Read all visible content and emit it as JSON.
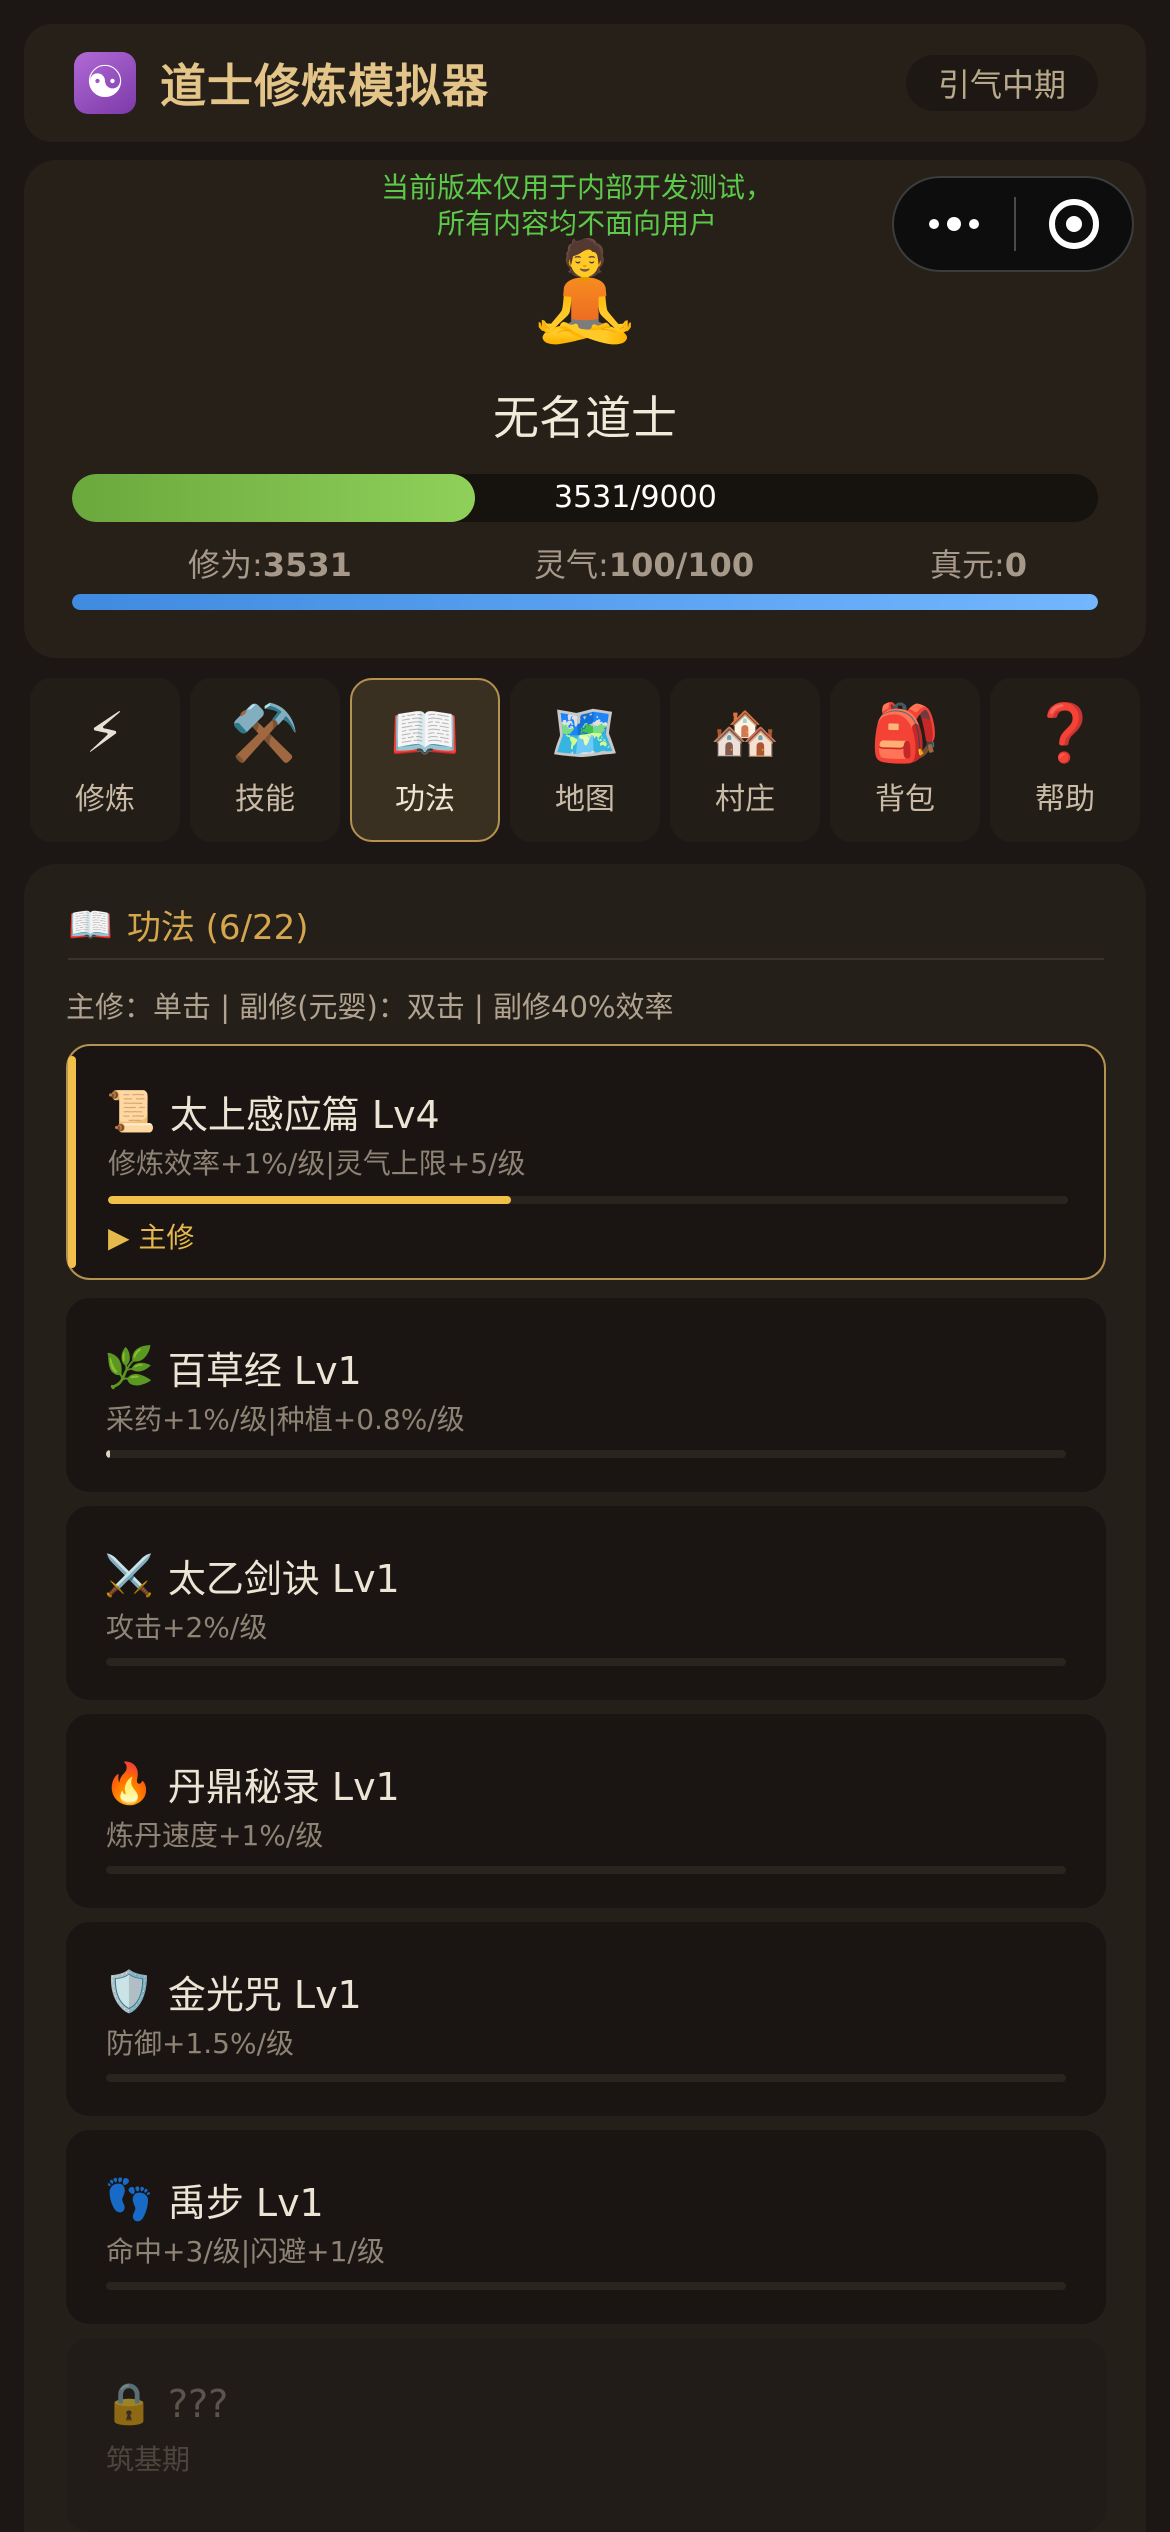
{
  "header": {
    "logo_icon": "☯",
    "title": "道士修炼模拟器",
    "realm": "引气中期"
  },
  "capsule": {
    "more_icon": "more-dots-icon",
    "close_icon": "target-close-icon"
  },
  "player": {
    "dev_notice_line1": "当前版本仅用于内部开发测试，",
    "dev_notice_line2": "所有内容均不面向用户",
    "avatar": "🧘",
    "name": "无名道士",
    "xp_text": "3531/9000",
    "xp_current": 3531,
    "xp_max": 9000,
    "stat_cultivation_label": "修为:",
    "stat_cultivation_value": "3531",
    "stat_qi_label": "灵气:",
    "stat_qi_value": "100/100",
    "stat_zhenyuan_label": "真元:",
    "stat_zhenyuan_value": "0",
    "qi_fraction": 1.0,
    "xp_color": "#8fd05a",
    "qi_color": "#73b6ff"
  },
  "nav": {
    "tabs": [
      {
        "icon": "⚡",
        "label": "修炼",
        "active": false
      },
      {
        "icon": "⚒️",
        "label": "技能",
        "active": false
      },
      {
        "icon": "📖",
        "label": "功法",
        "active": true
      },
      {
        "icon": "🗺️",
        "label": "地图",
        "active": false
      },
      {
        "icon": "🏘️",
        "label": "村庄",
        "active": false
      },
      {
        "icon": "🎒",
        "label": "背包",
        "active": false
      },
      {
        "icon": "❓",
        "label": "帮助",
        "active": false
      }
    ]
  },
  "techniques": {
    "title_icon": "📖",
    "title": "功法 (6/22)",
    "subtitle": "主修：单击 | 副修(元婴)：双击 | 副修40%效率",
    "main_tag": "▶ 主修",
    "items": [
      {
        "icon": "📜",
        "name": "太上感应篇 Lv4",
        "desc": "修炼效率+1%/级|灵气上限+5/级",
        "progress": 0.42
      },
      {
        "icon": "🌿",
        "name": "百草经 Lv1",
        "desc": "采药+1%/级|种植+0.8%/级",
        "progress": 0.004
      },
      {
        "icon": "⚔️",
        "name": "太乙剑诀 Lv1",
        "desc": "攻击+2%/级",
        "progress": 0
      },
      {
        "icon": "🔥",
        "name": "丹鼎秘录 Lv1",
        "desc": "炼丹速度+1%/级",
        "progress": 0
      },
      {
        "icon": "🛡️",
        "name": "金光咒 Lv1",
        "desc": "防御+1.5%/级",
        "progress": 0
      },
      {
        "icon": "👣",
        "name": "禹步 Lv1",
        "desc": "命中+3/级|闪避+1/级",
        "progress": 0
      },
      {
        "icon": "🔒",
        "name": "???",
        "desc": "筑基期",
        "progress": 0
      }
    ]
  }
}
